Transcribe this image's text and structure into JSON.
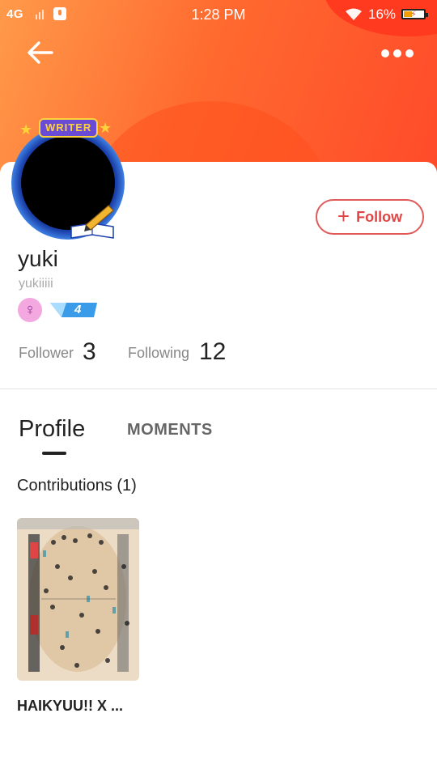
{
  "status_bar": {
    "network": "4G",
    "time": "1:28 PM",
    "battery_percent": "16%",
    "battery_level": 0.16
  },
  "header": {
    "accent_gradient": [
      "#ff9a4a",
      "#ff4a2a"
    ]
  },
  "profile": {
    "badge_label": "WRITER",
    "name": "yuki",
    "handle": "yukiiiii",
    "gender_icon": "female-icon",
    "level": "4",
    "follow_label": "Follow",
    "follower_label": "Follower",
    "follower_count": "3",
    "following_label": "Following",
    "following_count": "12"
  },
  "tabs": {
    "profile": "Profile",
    "moments": "MOMENTS"
  },
  "contributions": {
    "title": "Contributions (1)",
    "items": [
      {
        "title": "HAIKYUU!! X ..."
      }
    ]
  },
  "colors": {
    "follow_accent": "#e04545",
    "level_badge": "#3a9be8"
  }
}
